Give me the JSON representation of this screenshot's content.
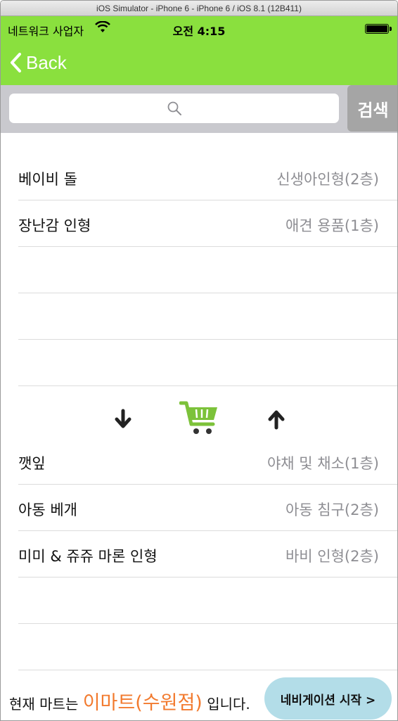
{
  "window": {
    "title": "iOS Simulator - iPhone 6 - iPhone 6 / iOS 8.1 (12B411)"
  },
  "status": {
    "carrier": "네트워크 사업자",
    "time": "오전 4:15"
  },
  "nav": {
    "back_label": "Back"
  },
  "search": {
    "placeholder": "",
    "button_label": "검색"
  },
  "top_list": [
    {
      "name": "베이비 돌",
      "location": "신생아인형(2층)"
    },
    {
      "name": "장난감 인형",
      "location": "애견 용품(1층)"
    },
    {
      "name": "",
      "location": ""
    },
    {
      "name": "",
      "location": ""
    },
    {
      "name": "",
      "location": ""
    }
  ],
  "bottom_list": [
    {
      "name": "깻잎",
      "location": "야채 및 채소(1층)"
    },
    {
      "name": "아동 베개",
      "location": "아동 침구(2층)"
    },
    {
      "name": "미미 & 쥬쥬 마론 인형",
      "location": "바비 인형(2층)"
    },
    {
      "name": "",
      "location": ""
    },
    {
      "name": "",
      "location": ""
    }
  ],
  "footer": {
    "prefix": "현재 마트는",
    "store": "이마트(수원점)",
    "suffix": "입니다.",
    "nav_button": "네비게이션 시작 >"
  },
  "colors": {
    "accent": "#8ae03e",
    "store_text": "#f27a2e",
    "nav_button_bg": "#b3dde8",
    "cart_icon": "#7cc23a"
  },
  "icons": [
    "wifi-icon",
    "battery-icon",
    "back-chevron-icon",
    "search-icon",
    "arrow-down-icon",
    "cart-icon",
    "arrow-up-icon"
  ]
}
